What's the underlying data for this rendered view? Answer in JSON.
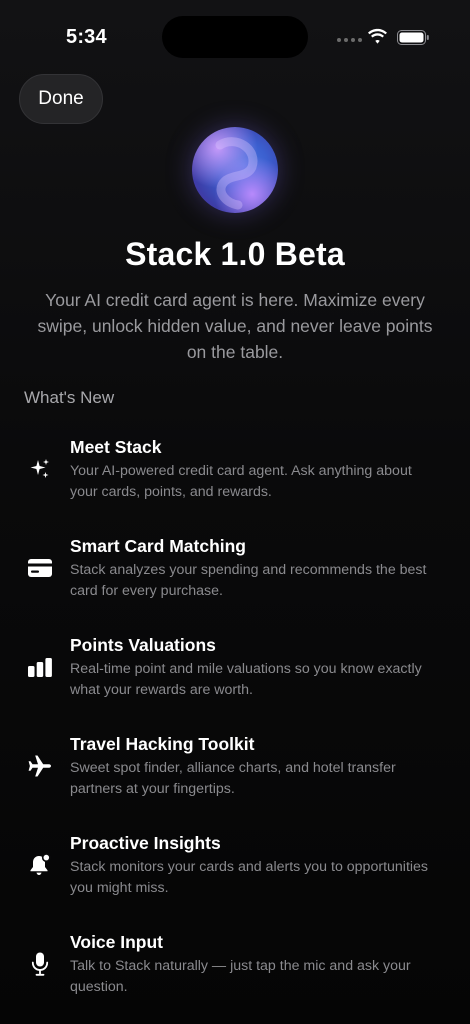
{
  "status_bar": {
    "time": "5:34"
  },
  "nav": {
    "done_label": "Done"
  },
  "header": {
    "title": "Stack 1.0 Beta",
    "subtitle": "Your AI credit card agent is here. Maximize every swipe, unlock hidden value, and never leave points on the table."
  },
  "whats_new": {
    "heading": "What's New",
    "items": [
      {
        "icon": "sparkles-icon",
        "title": "Meet Stack",
        "description": "Your AI-powered credit card agent. Ask anything about your cards, points, and rewards."
      },
      {
        "icon": "credit-card-icon",
        "title": "Smart Card Matching",
        "description": "Stack analyzes your spending and recommends the best card for every purchase."
      },
      {
        "icon": "bar-chart-icon",
        "title": "Points Valuations",
        "description": "Real-time point and mile valuations so you know exactly what your rewards are worth."
      },
      {
        "icon": "airplane-icon",
        "title": "Travel Hacking Toolkit",
        "description": "Sweet spot finder, alliance charts, and hotel transfer partners at your fingertips."
      },
      {
        "icon": "bell-badge-icon",
        "title": "Proactive Insights",
        "description": "Stack monitors your cards and alerts you to opportunities you might miss."
      },
      {
        "icon": "microphone-icon",
        "title": "Voice Input",
        "description": "Talk to Stack naturally — just tap the mic and ask your question."
      }
    ]
  },
  "colors": {
    "background": "#0a0a0b",
    "text_primary": "#ffffff",
    "text_secondary": "#8a8a8e",
    "button_bg": "#242426",
    "orb_blue": "#3b5fcf",
    "orb_purple": "#8a5ae8"
  }
}
